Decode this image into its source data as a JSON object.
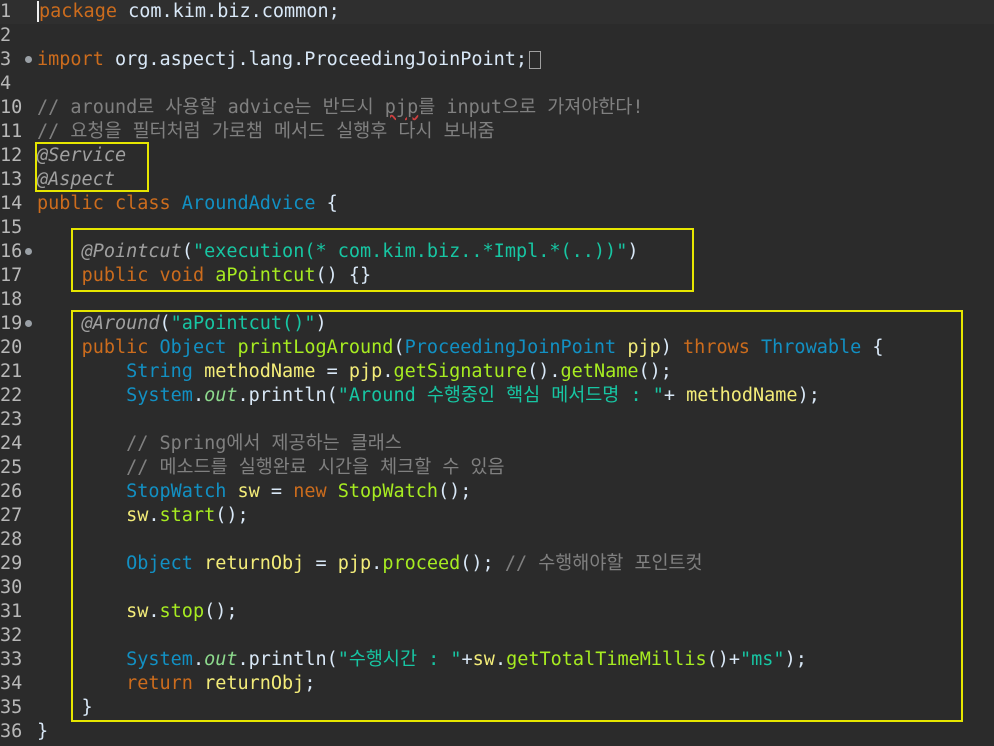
{
  "editor": {
    "language": "java",
    "lines": [
      {
        "n": "1",
        "tokens": [
          {
            "t": "kw",
            "v": "package"
          },
          {
            "t": "plain",
            "v": " com.kim.biz.common;"
          }
        ]
      },
      {
        "n": "2",
        "tokens": []
      },
      {
        "n": "3",
        "tokens": [
          {
            "t": "kw",
            "v": "import"
          },
          {
            "t": "plain",
            "v": " org.aspectj.lang.ProceedingJoinPoint;"
          }
        ]
      },
      {
        "n": "4",
        "tokens": []
      },
      {
        "n": "10",
        "tokens": [
          {
            "t": "cmt",
            "v": "// around로 사용할 advice는 반드시 pjp를 input으로 가져야한다!"
          }
        ]
      },
      {
        "n": "11",
        "tokens": [
          {
            "t": "cmt",
            "v": "// 요청을 필터처럼 가로챔 메서드 실행후 다시 보내줌"
          }
        ]
      },
      {
        "n": "12",
        "tokens": [
          {
            "t": "ann",
            "v": "@Service"
          }
        ]
      },
      {
        "n": "13",
        "tokens": [
          {
            "t": "ann",
            "v": "@Aspect"
          }
        ]
      },
      {
        "n": "14",
        "tokens": [
          {
            "t": "kw",
            "v": "public class "
          },
          {
            "t": "cls",
            "v": "AroundAdvice"
          },
          {
            "t": "plain",
            "v": " {"
          }
        ]
      },
      {
        "n": "15",
        "tokens": []
      },
      {
        "n": "16",
        "tokens": [
          {
            "t": "plain",
            "v": "    "
          },
          {
            "t": "ann",
            "v": "@Pointcut"
          },
          {
            "t": "plain",
            "v": "("
          },
          {
            "t": "str",
            "v": "\"execution(* com.kim.biz..*Impl.*(..))\""
          },
          {
            "t": "plain",
            "v": ")"
          }
        ]
      },
      {
        "n": "17",
        "tokens": [
          {
            "t": "plain",
            "v": "    "
          },
          {
            "t": "kw",
            "v": "public void "
          },
          {
            "t": "meth",
            "v": "aPointcut"
          },
          {
            "t": "plain",
            "v": "() {}"
          }
        ]
      },
      {
        "n": "18",
        "tokens": []
      },
      {
        "n": "19",
        "tokens": [
          {
            "t": "plain",
            "v": "    "
          },
          {
            "t": "ann",
            "v": "@Around"
          },
          {
            "t": "plain",
            "v": "("
          },
          {
            "t": "str",
            "v": "\"aPointcut()\""
          },
          {
            "t": "plain",
            "v": ")"
          }
        ]
      },
      {
        "n": "20",
        "tokens": [
          {
            "t": "plain",
            "v": "    "
          },
          {
            "t": "kw",
            "v": "public "
          },
          {
            "t": "cls",
            "v": "Object "
          },
          {
            "t": "meth",
            "v": "printLogAround"
          },
          {
            "t": "plain",
            "v": "("
          },
          {
            "t": "cls",
            "v": "ProceedingJoinPoint "
          },
          {
            "t": "var",
            "v": "pjp"
          },
          {
            "t": "plain",
            "v": ") "
          },
          {
            "t": "kw",
            "v": "throws "
          },
          {
            "t": "cls",
            "v": "Throwable"
          },
          {
            "t": "plain",
            "v": " {"
          }
        ]
      },
      {
        "n": "21",
        "tokens": [
          {
            "t": "plain",
            "v": "        "
          },
          {
            "t": "cls",
            "v": "String "
          },
          {
            "t": "var",
            "v": "methodName"
          },
          {
            "t": "plain",
            "v": " = "
          },
          {
            "t": "var",
            "v": "pjp"
          },
          {
            "t": "plain",
            "v": "."
          },
          {
            "t": "meth",
            "v": "getSignature"
          },
          {
            "t": "plain",
            "v": "()."
          },
          {
            "t": "meth",
            "v": "getName"
          },
          {
            "t": "plain",
            "v": "();"
          }
        ]
      },
      {
        "n": "22",
        "tokens": [
          {
            "t": "plain",
            "v": "        "
          },
          {
            "t": "cls",
            "v": "System"
          },
          {
            "t": "plain",
            "v": "."
          },
          {
            "t": "sfld",
            "v": "out"
          },
          {
            "t": "plain",
            "v": ".println("
          },
          {
            "t": "str",
            "v": "\"Around 수행중인 핵심 메서드명 : \""
          },
          {
            "t": "plain",
            "v": "+ "
          },
          {
            "t": "var",
            "v": "methodName"
          },
          {
            "t": "plain",
            "v": ");"
          }
        ]
      },
      {
        "n": "23",
        "tokens": []
      },
      {
        "n": "24",
        "tokens": [
          {
            "t": "plain",
            "v": "        "
          },
          {
            "t": "cmt",
            "v": "// Spring에서 제공하는 클래스"
          }
        ]
      },
      {
        "n": "25",
        "tokens": [
          {
            "t": "plain",
            "v": "        "
          },
          {
            "t": "cmt",
            "v": "// 메소드를 실행완료 시간을 체크할 수 있음"
          }
        ]
      },
      {
        "n": "26",
        "tokens": [
          {
            "t": "plain",
            "v": "        "
          },
          {
            "t": "cls",
            "v": "StopWatch "
          },
          {
            "t": "var",
            "v": "sw"
          },
          {
            "t": "plain",
            "v": " = "
          },
          {
            "t": "kw",
            "v": "new "
          },
          {
            "t": "meth",
            "v": "StopWatch"
          },
          {
            "t": "plain",
            "v": "();"
          }
        ]
      },
      {
        "n": "27",
        "tokens": [
          {
            "t": "plain",
            "v": "        "
          },
          {
            "t": "var",
            "v": "sw"
          },
          {
            "t": "plain",
            "v": "."
          },
          {
            "t": "meth",
            "v": "start"
          },
          {
            "t": "plain",
            "v": "();"
          }
        ]
      },
      {
        "n": "28",
        "tokens": []
      },
      {
        "n": "29",
        "tokens": [
          {
            "t": "plain",
            "v": "        "
          },
          {
            "t": "cls",
            "v": "Object "
          },
          {
            "t": "var",
            "v": "returnObj"
          },
          {
            "t": "plain",
            "v": " = "
          },
          {
            "t": "var",
            "v": "pjp"
          },
          {
            "t": "plain",
            "v": "."
          },
          {
            "t": "meth",
            "v": "proceed"
          },
          {
            "t": "plain",
            "v": "(); "
          },
          {
            "t": "cmt",
            "v": "// 수행해야할 포인트컷"
          }
        ]
      },
      {
        "n": "30",
        "tokens": []
      },
      {
        "n": "31",
        "tokens": [
          {
            "t": "plain",
            "v": "        "
          },
          {
            "t": "var",
            "v": "sw"
          },
          {
            "t": "plain",
            "v": "."
          },
          {
            "t": "meth",
            "v": "stop"
          },
          {
            "t": "plain",
            "v": "();"
          }
        ]
      },
      {
        "n": "32",
        "tokens": []
      },
      {
        "n": "33",
        "tokens": [
          {
            "t": "plain",
            "v": "        "
          },
          {
            "t": "cls",
            "v": "System"
          },
          {
            "t": "plain",
            "v": "."
          },
          {
            "t": "sfld",
            "v": "out"
          },
          {
            "t": "plain",
            "v": ".println("
          },
          {
            "t": "str",
            "v": "\"수행시간 : \""
          },
          {
            "t": "plain",
            "v": "+"
          },
          {
            "t": "var",
            "v": "sw"
          },
          {
            "t": "plain",
            "v": "."
          },
          {
            "t": "meth",
            "v": "getTotalTimeMillis"
          },
          {
            "t": "plain",
            "v": "()+"
          },
          {
            "t": "str",
            "v": "\"ms\""
          },
          {
            "t": "plain",
            "v": ");"
          }
        ]
      },
      {
        "n": "34",
        "tokens": [
          {
            "t": "plain",
            "v": "        "
          },
          {
            "t": "kw",
            "v": "return "
          },
          {
            "t": "var",
            "v": "returnObj"
          },
          {
            "t": "plain",
            "v": ";"
          }
        ]
      },
      {
        "n": "35",
        "tokens": [
          {
            "t": "plain",
            "v": "    }"
          }
        ]
      },
      {
        "n": "36",
        "tokens": [
          {
            "t": "plain",
            "v": "}"
          }
        ]
      }
    ],
    "fold_markers": [
      "3",
      "16",
      "19"
    ],
    "collapsed_import_marker": "3",
    "highlight_color": "#e6e600"
  }
}
